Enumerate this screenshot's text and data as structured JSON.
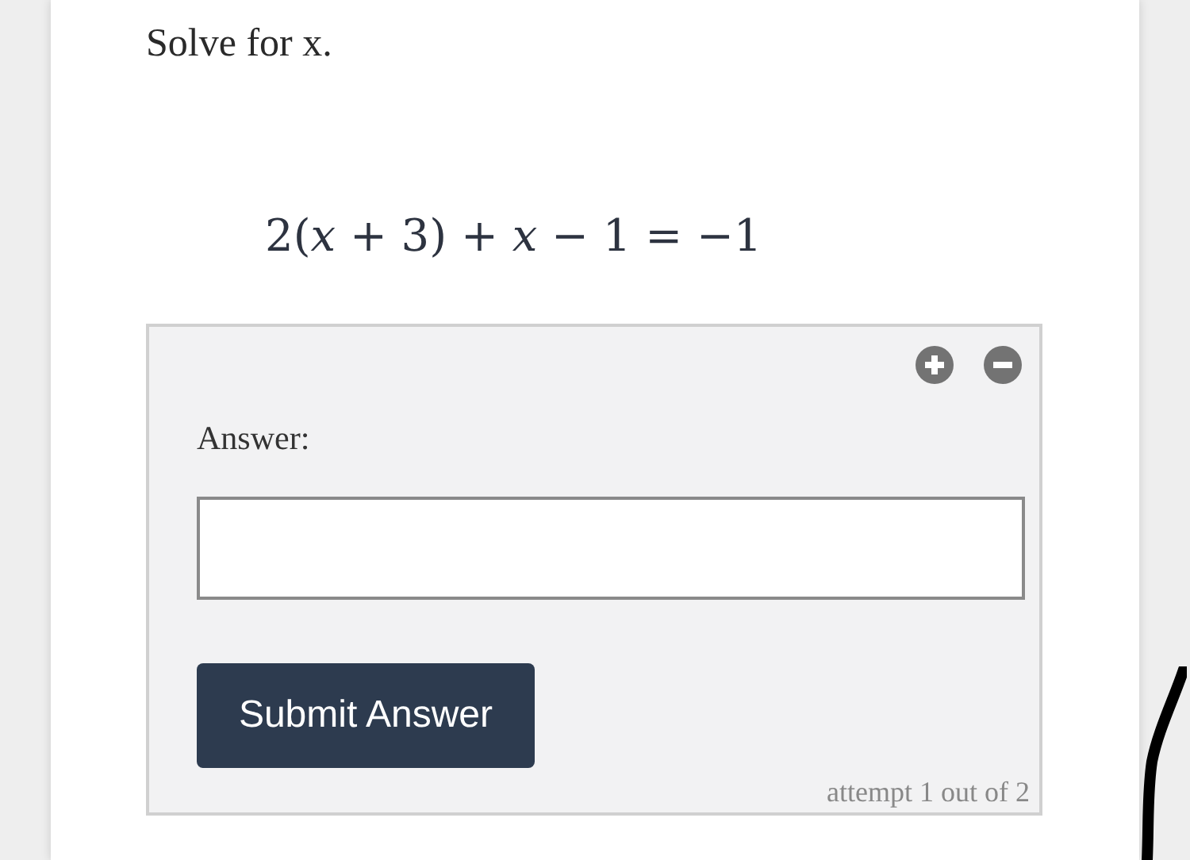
{
  "prompt": "Solve for x.",
  "equation": "2(*x* + 3) + *x* − 1 = −1",
  "answer_panel": {
    "label": "Answer:",
    "submit_button": "Submit Answer",
    "attempt": "attempt 1 out of 2"
  }
}
